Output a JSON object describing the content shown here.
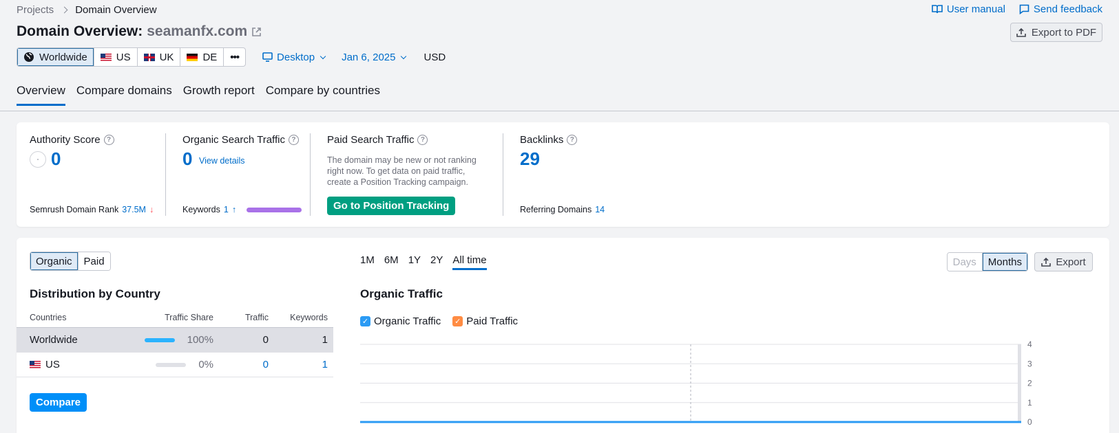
{
  "breadcrumb": {
    "projects": "Projects",
    "current": "Domain Overview"
  },
  "top_links": {
    "manual": "User manual",
    "feedback": "Send feedback"
  },
  "title": {
    "prefix": "Domain Overview:",
    "domain": "seamanfx.com"
  },
  "export_pdf": "Export to PDF",
  "filters": {
    "regions": [
      {
        "label": "Worldwide",
        "icon": "globe-icon",
        "active": true
      },
      {
        "label": "US",
        "icon": "us-flag-icon"
      },
      {
        "label": "UK",
        "icon": "uk-flag-icon"
      },
      {
        "label": "DE",
        "icon": "de-flag-icon"
      }
    ],
    "more": "•••",
    "device": "Desktop",
    "date": "Jan 6, 2025",
    "currency": "USD"
  },
  "tabs": [
    "Overview",
    "Compare domains",
    "Growth report",
    "Compare by countries"
  ],
  "metrics": {
    "authority": {
      "title": "Authority Score",
      "value": "0",
      "rank_label": "Semrush Domain Rank",
      "rank_value": "37.5M",
      "rank_trend": "↓"
    },
    "organic": {
      "title": "Organic Search Traffic",
      "value": "0",
      "details": "View details",
      "kw_label": "Keywords",
      "kw_value": "1",
      "kw_trend": "↑"
    },
    "paid": {
      "title": "Paid Search Traffic",
      "text": "The domain may be new or not ranking right now. To get data on paid traffic, create a Position Tracking campaign.",
      "button": "Go to Position Tracking"
    },
    "backlinks": {
      "title": "Backlinks",
      "value": "29",
      "ref_label": "Referring Domains",
      "ref_value": "14"
    }
  },
  "distribution": {
    "toggle": [
      "Organic",
      "Paid"
    ],
    "title": "Distribution by Country",
    "headers": [
      "Countries",
      "Traffic Share",
      "Traffic",
      "Keywords"
    ],
    "rows": [
      {
        "country": "Worldwide",
        "share": "100%",
        "traffic": "0",
        "keywords": "1"
      },
      {
        "country": "US",
        "share": "0%",
        "traffic": "0",
        "keywords": "1"
      }
    ],
    "compare": "Compare"
  },
  "traffic": {
    "periods": [
      "1M",
      "6M",
      "1Y",
      "2Y",
      "All time"
    ],
    "active_period": "All time",
    "granularity": [
      "Days",
      "Months"
    ],
    "export": "Export",
    "title": "Organic Traffic",
    "legend": [
      {
        "label": "Organic Traffic",
        "color": "#2b9bf4"
      },
      {
        "label": "Paid Traffic",
        "color": "#ff8c43"
      }
    ]
  },
  "chart_data": {
    "type": "line",
    "title": "Organic Traffic",
    "ylim": [
      0,
      4
    ],
    "yticks": [
      "4",
      "3",
      "2",
      "1",
      "0"
    ],
    "series": [
      {
        "name": "Organic Traffic",
        "values": [
          0,
          0
        ]
      },
      {
        "name": "Paid Traffic",
        "values": [
          0,
          0
        ]
      }
    ],
    "grid": true
  }
}
